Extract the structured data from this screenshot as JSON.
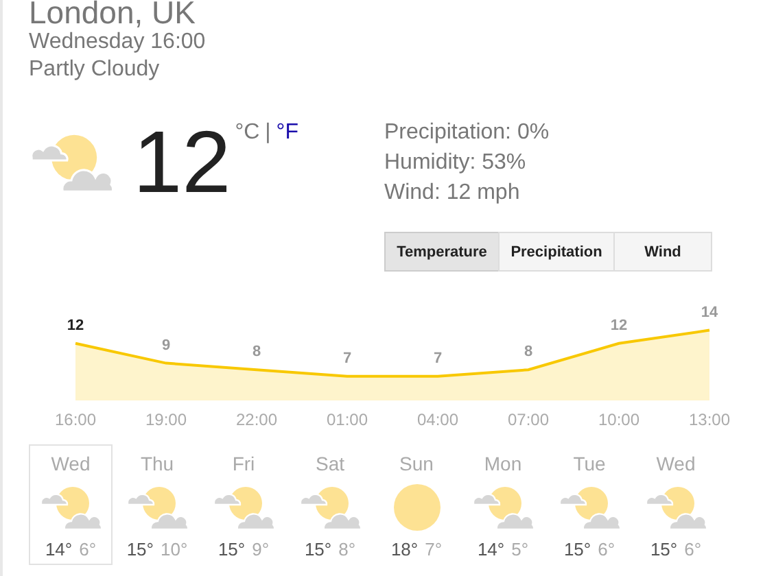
{
  "location": "London, UK",
  "datetime": "Wednesday 16:00",
  "condition": "Partly Cloudy",
  "current": {
    "kind": "partly-cloudy",
    "temperature": "12",
    "units": [
      {
        "label": "°C",
        "selected": true
      },
      {
        "label": "°F",
        "selected": false
      }
    ],
    "unit_separator": "|"
  },
  "details": [
    "Precipitation: 0%",
    "Humidity: 53%",
    "Wind: 12 mph"
  ],
  "tabs": [
    {
      "label": "Temperature",
      "selected": true
    },
    {
      "label": "Precipitation",
      "selected": false
    },
    {
      "label": "Wind",
      "selected": false
    }
  ],
  "chart_data": {
    "type": "area",
    "categories": [
      "16:00",
      "19:00",
      "22:00",
      "01:00",
      "04:00",
      "07:00",
      "10:00",
      "13:00"
    ],
    "series": [
      {
        "color": "#f8c800",
        "values": [
          12,
          9,
          8,
          7,
          7,
          8,
          12,
          14
        ]
      }
    ],
    "data_labels": true
  },
  "days": [
    {
      "name": "Wed",
      "kind": "partly-cloudy",
      "high": "14°",
      "low": "6°",
      "selected": true
    },
    {
      "name": "Thu",
      "kind": "partly-cloudy",
      "high": "15°",
      "low": "10°",
      "selected": false
    },
    {
      "name": "Fri",
      "kind": "partly-cloudy",
      "high": "15°",
      "low": "9°",
      "selected": false
    },
    {
      "name": "Sat",
      "kind": "partly-cloudy",
      "high": "15°",
      "low": "8°",
      "selected": false
    },
    {
      "name": "Sun",
      "kind": "sunny",
      "high": "18°",
      "low": "7°",
      "selected": false
    },
    {
      "name": "Mon",
      "kind": "partly-cloudy",
      "high": "14°",
      "low": "5°",
      "selected": false
    },
    {
      "name": "Tue",
      "kind": "partly-cloudy",
      "high": "15°",
      "low": "6°",
      "selected": false
    },
    {
      "name": "Wed",
      "kind": "partly-cloudy",
      "high": "15°",
      "low": "6°",
      "selected": false
    }
  ]
}
